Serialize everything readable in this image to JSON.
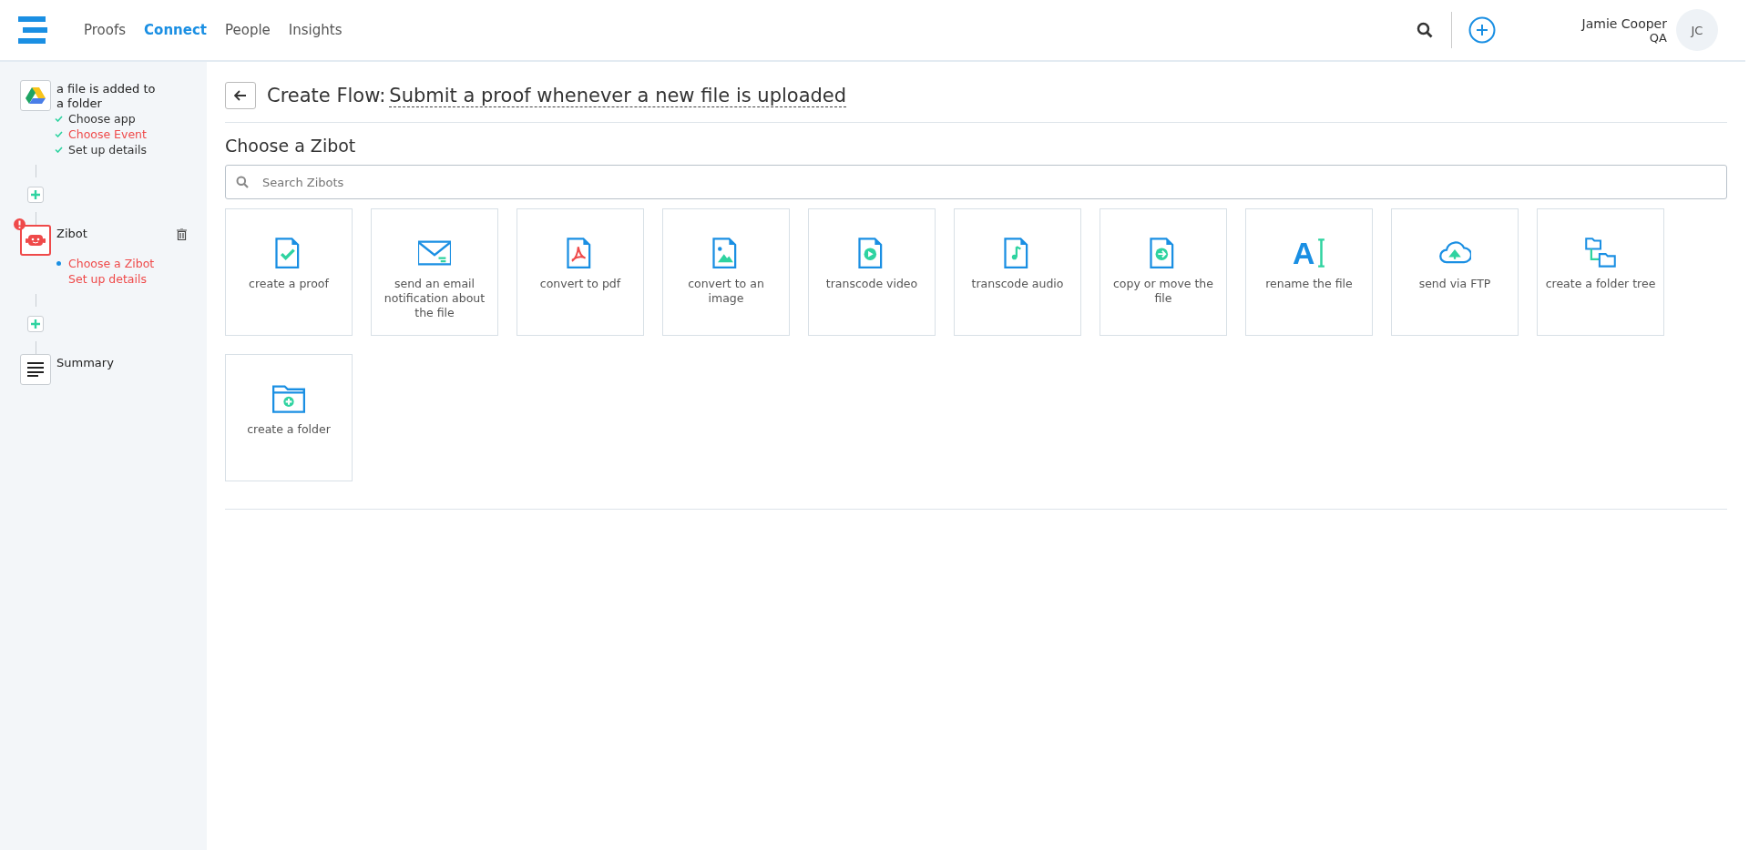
{
  "nav": {
    "items": [
      {
        "label": "Proofs",
        "selected": false
      },
      {
        "label": "Connect",
        "selected": true
      },
      {
        "label": "People",
        "selected": false
      },
      {
        "label": "Insights",
        "selected": false
      }
    ]
  },
  "user": {
    "name": "Jamie Cooper",
    "role": "QA",
    "initials": "JC"
  },
  "steps": [
    {
      "kind": "drive",
      "title": "a file is added to a folder",
      "error": false,
      "deletable": false,
      "substeps": [
        {
          "label": "Choose app",
          "done": true,
          "current": false,
          "error": false
        },
        {
          "label": "Choose Event",
          "done": true,
          "current": false,
          "error": true
        },
        {
          "label": "Set up details",
          "done": true,
          "current": false,
          "error": false
        }
      ]
    },
    {
      "kind": "zibot",
      "title": "Zibot",
      "error": true,
      "deletable": true,
      "substeps": [
        {
          "label": "Choose a Zibot",
          "done": false,
          "current": true,
          "error": true
        },
        {
          "label": "Set up details",
          "done": false,
          "current": false,
          "error": true
        }
      ]
    },
    {
      "kind": "summary",
      "title": "Summary",
      "error": false,
      "deletable": false
    }
  ],
  "header": {
    "prefix": "Create Flow:",
    "flow_name": "Submit a proof whenever a new file is uploaded"
  },
  "section_title": "Choose a Zibot",
  "search": {
    "placeholder": "Search Zibots"
  },
  "zibots": [
    {
      "kind": "proof",
      "label": "create a proof"
    },
    {
      "kind": "email",
      "label": "send an email notification about the file"
    },
    {
      "kind": "pdf",
      "label": "convert to pdf"
    },
    {
      "kind": "image",
      "label": "convert to an image"
    },
    {
      "kind": "video",
      "label": "transcode video"
    },
    {
      "kind": "audio",
      "label": "transcode audio"
    },
    {
      "kind": "move",
      "label": "copy or move the file"
    },
    {
      "kind": "rename",
      "glyph": "A",
      "label": "rename the file"
    },
    {
      "kind": "ftp",
      "label": "send via FTP"
    },
    {
      "kind": "tree",
      "label": "create a folder tree"
    },
    {
      "kind": "folder",
      "label": "create a folder"
    }
  ]
}
